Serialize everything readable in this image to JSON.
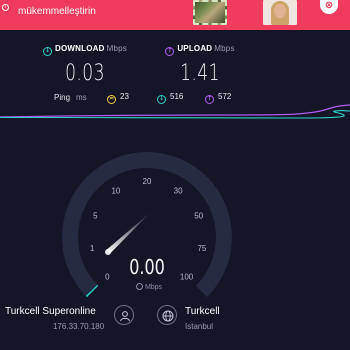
{
  "ad": {
    "info_glyph": "i",
    "text": "mükemmelleştirin",
    "close_glyph": "⊗"
  },
  "download": {
    "label": "DOWNLOAD",
    "unit": "Mbps",
    "value": "0.03",
    "icon": "arrow-down-circle-icon",
    "color": "#2fd3c9"
  },
  "upload": {
    "label": "UPLOAD",
    "unit": "Mbps",
    "value": "1.41",
    "icon": "arrow-up-circle-icon",
    "color": "#b25cf0"
  },
  "ping": {
    "label": "Ping",
    "unit": "ms",
    "idle": "23",
    "download": "516",
    "upload": "572",
    "idle_color": "#f4d03f"
  },
  "gauge": {
    "ticks": [
      "0",
      "1",
      "5",
      "10",
      "20",
      "30",
      "50",
      "75",
      "100"
    ],
    "value": 0.03,
    "readout": "0.00",
    "unit": "Mbps",
    "progress_color": "#2fd3c9"
  },
  "server": {
    "isp_name": "Turkcell Superonline",
    "isp_ip": "176.33.70.180",
    "host_name": "Turkcell",
    "host_location": "Istanbul"
  },
  "colors": {
    "background": "#141526",
    "ad_banner": "#ee3b5e"
  }
}
